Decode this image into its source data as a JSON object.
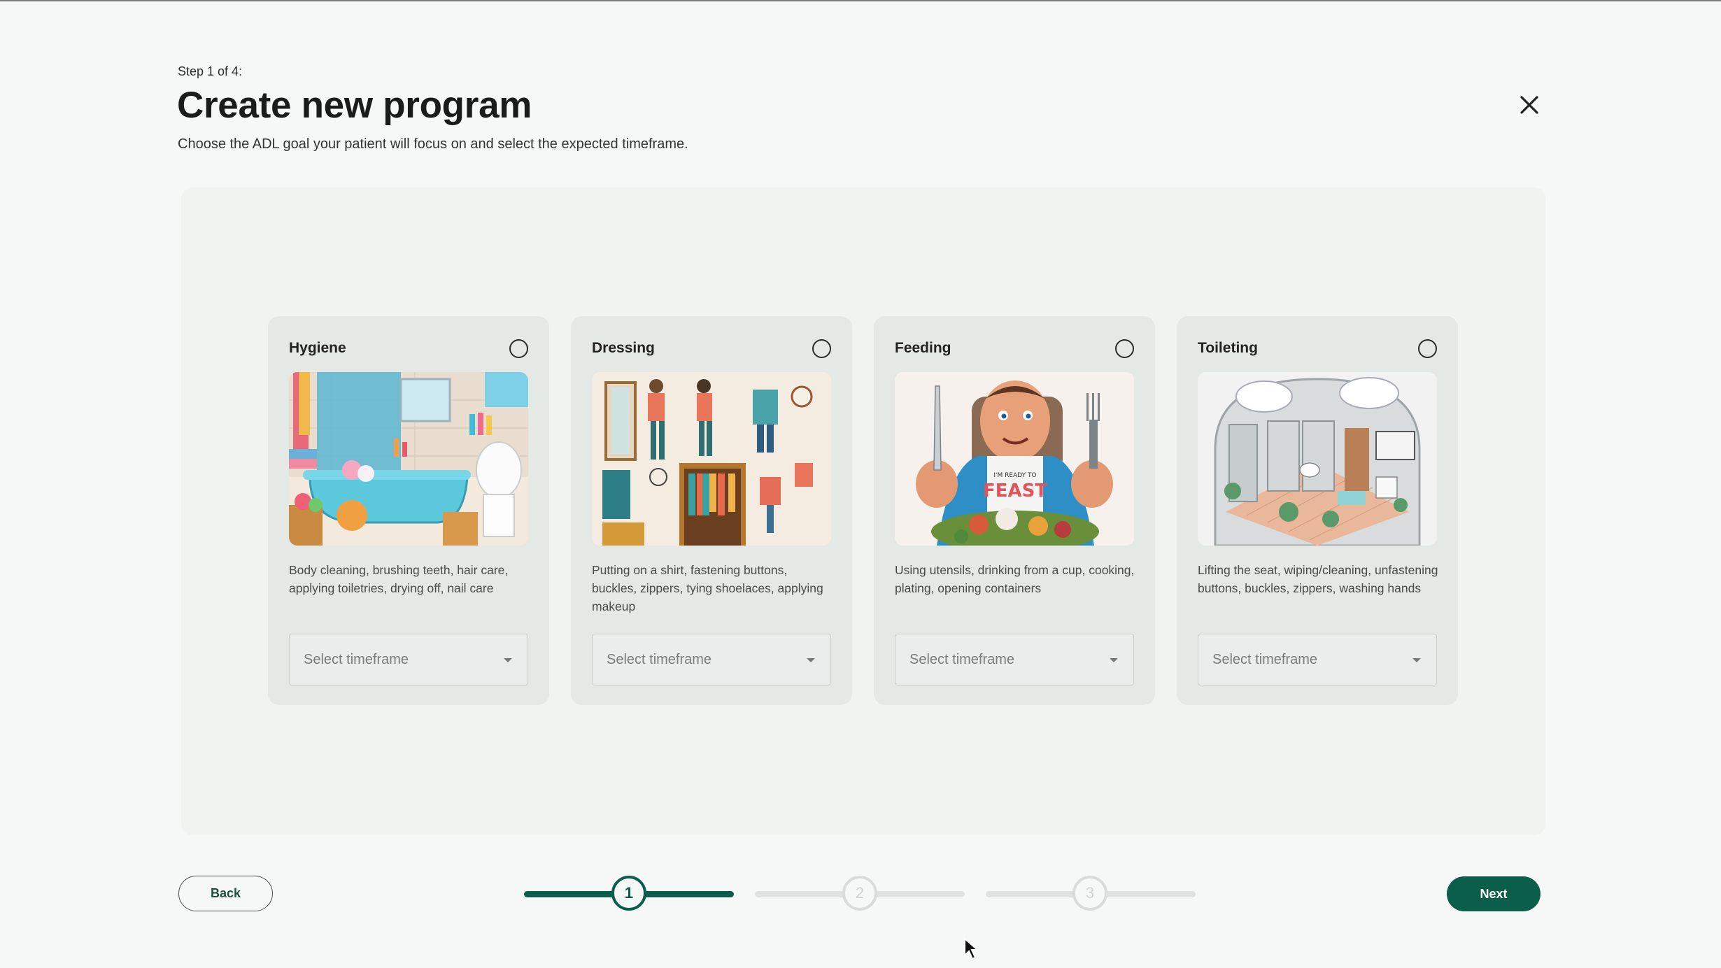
{
  "header": {
    "step_label": "Step 1 of 4:",
    "title": "Create new program",
    "subtitle": "Choose the ADL goal your patient will focus on and select the expected timeframe.",
    "close_icon": "close-icon"
  },
  "cards": [
    {
      "title": "Hygiene",
      "description": "Body cleaning, brushing teeth, hair care, applying toiletries, drying off, nail care",
      "select_placeholder": "Select timeframe",
      "selected": false
    },
    {
      "title": "Dressing",
      "description": "Putting on a shirt, fastening buttons, buckles, zippers, tying shoelaces, applying makeup",
      "select_placeholder": "Select timeframe",
      "selected": false
    },
    {
      "title": "Feeding",
      "description": "Using utensils, drinking from a cup, cooking, plating, opening containers",
      "select_placeholder": "Select timeframe",
      "selected": false
    },
    {
      "title": "Toileting",
      "description": "Lifting the seat, wiping/cleaning, unfastening buttons, buckles, zippers, washing hands",
      "select_placeholder": "Select timeframe",
      "selected": false
    }
  ],
  "footer": {
    "back_label": "Back",
    "next_label": "Next",
    "steps": [
      "1",
      "2",
      "3"
    ],
    "current_step": 1
  },
  "colors": {
    "primary": "#0b5e4a",
    "background": "#f6f8f7",
    "card": "#e5e9e6"
  }
}
